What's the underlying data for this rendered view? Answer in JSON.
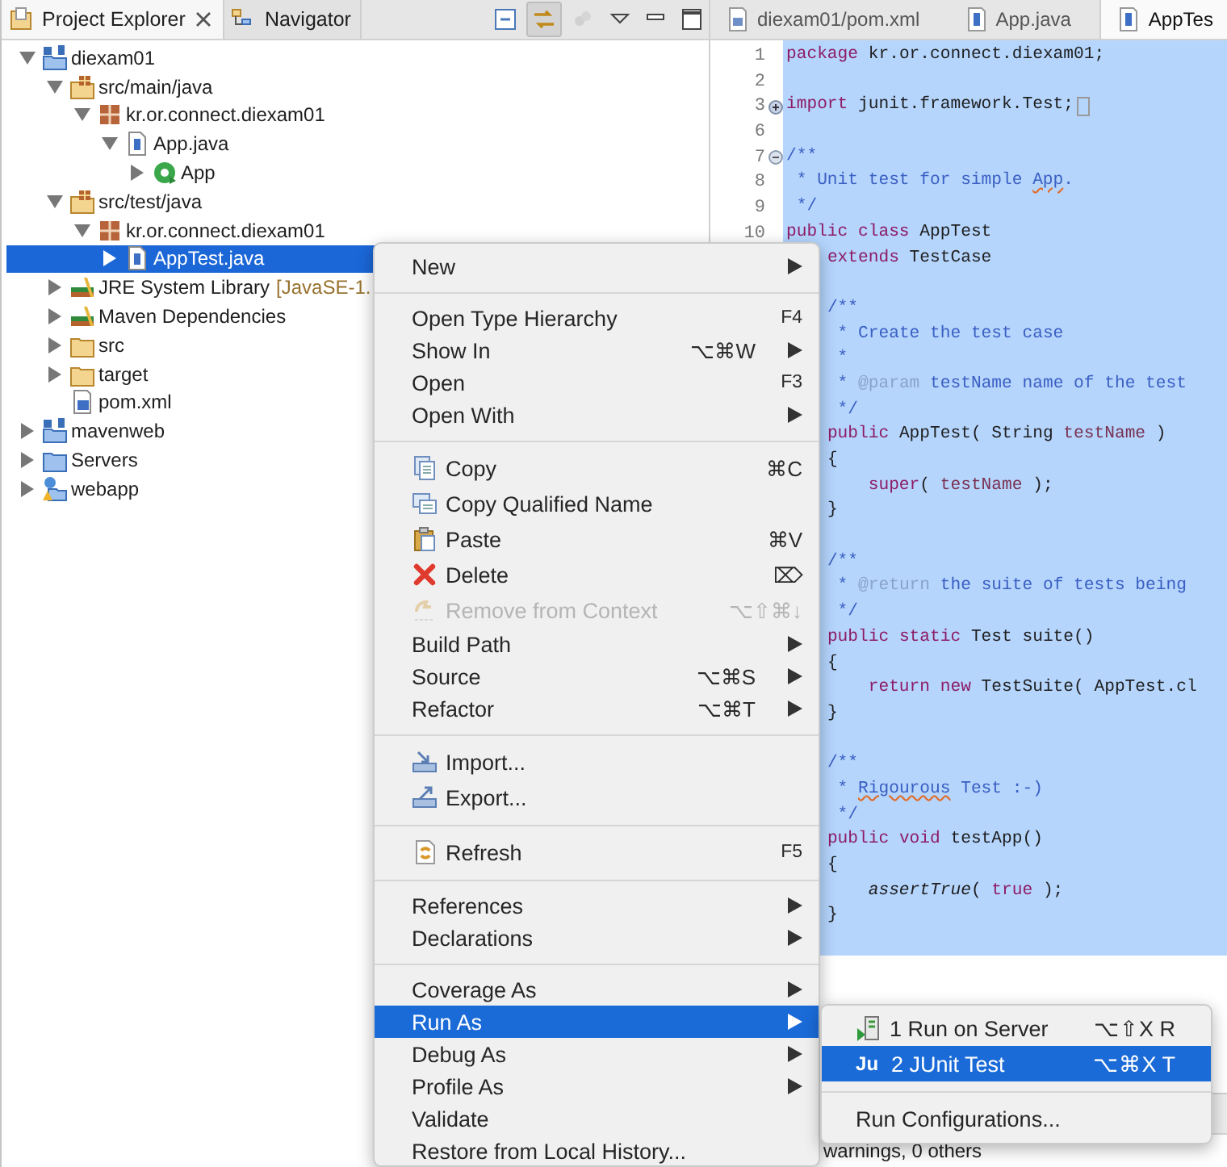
{
  "view_tabs": [
    {
      "label": "Project Explorer",
      "kind": "explorer",
      "selected": true
    },
    {
      "label": "Navigator",
      "kind": "navigator",
      "selected": false
    }
  ],
  "view_toolbar": [
    {
      "kind": "collapse-all",
      "on": false,
      "disabled": false
    },
    {
      "kind": "link",
      "on": true,
      "disabled": false
    },
    {
      "kind": "filter",
      "on": false,
      "disabled": true
    }
  ],
  "tree": [
    {
      "label": "diexam01",
      "kind": "maven-project",
      "expanded": true,
      "selected": false,
      "children": [
        {
          "label": "src/main/java",
          "kind": "source-folder",
          "expanded": true,
          "selected": false,
          "children": [
            {
              "label": "kr.or.connect.diexam01",
              "kind": "package",
              "expanded": true,
              "selected": false,
              "children": [
                {
                  "label": "App.java",
                  "kind": "java-file",
                  "expanded": true,
                  "selected": false,
                  "children": [
                    {
                      "label": "App",
                      "kind": "class",
                      "expanded": false,
                      "selected": false
                    }
                  ]
                }
              ]
            }
          ]
        },
        {
          "label": "src/test/java",
          "kind": "source-folder",
          "expanded": true,
          "selected": false,
          "children": [
            {
              "label": "kr.or.connect.diexam01",
              "kind": "package",
              "expanded": true,
              "selected": false,
              "children": [
                {
                  "label": "AppTest.java",
                  "kind": "java-file",
                  "expanded": false,
                  "selected": true
                }
              ]
            }
          ]
        },
        {
          "label": "JRE System Library",
          "detail": "[JavaSE-1.",
          "kind": "library",
          "expanded": false,
          "selected": false
        },
        {
          "label": "Maven Dependencies",
          "kind": "library",
          "expanded": false,
          "selected": false
        },
        {
          "label": "src",
          "kind": "folder",
          "expanded": false,
          "selected": false
        },
        {
          "label": "target",
          "kind": "folder",
          "expanded": false,
          "selected": false
        },
        {
          "label": "pom.xml",
          "kind": "xml-file",
          "selected": false
        }
      ]
    },
    {
      "label": "mavenweb",
      "kind": "maven-project",
      "expanded": false,
      "selected": false
    },
    {
      "label": "Servers",
      "kind": "server-folder",
      "expanded": false,
      "selected": false
    },
    {
      "label": "webapp",
      "kind": "web-project",
      "expanded": false,
      "selected": false
    }
  ],
  "editor_tabs": [
    {
      "label": "diexam01/pom.xml",
      "kind": "xml",
      "selected": false
    },
    {
      "label": "App.java",
      "kind": "java",
      "selected": false
    },
    {
      "label": "AppTes",
      "kind": "java",
      "selected": true
    }
  ],
  "code_lines": [
    {
      "kind": "code",
      "number": "1",
      "segments": [
        {
          "kind": "keyword",
          "text": "package"
        },
        {
          "kind": "plain",
          "text": " kr.or.connect.diexam01;"
        }
      ]
    },
    {
      "kind": "blank",
      "number": "2"
    },
    {
      "kind": "code",
      "number": "3",
      "expanded": false,
      "segments": [
        {
          "kind": "keyword",
          "text": "import"
        },
        {
          "kind": "plain",
          "text": " junit.framework.Test;"
        }
      ]
    },
    {
      "kind": "blank",
      "number": "6"
    },
    {
      "kind": "code",
      "number": "7",
      "expanded": true,
      "segments": [
        {
          "kind": "doc",
          "text": "/**"
        }
      ]
    },
    {
      "kind": "code",
      "number": "8",
      "segments": [
        {
          "kind": "doc",
          "text": " * Unit test for simple "
        },
        {
          "kind": "misspelled",
          "text": "App"
        },
        {
          "kind": "doc",
          "text": "."
        }
      ]
    },
    {
      "kind": "code",
      "number": "9",
      "segments": [
        {
          "kind": "doc",
          "text": " */"
        }
      ]
    },
    {
      "kind": "code",
      "number": "10",
      "segments": [
        {
          "kind": "keyword",
          "text": "public class"
        },
        {
          "kind": "plain",
          "text": " AppTest"
        }
      ]
    },
    {
      "kind": "code",
      "segments": [
        {
          "kind": "keyword",
          "text": "    extends"
        },
        {
          "kind": "plain",
          "text": " TestCase"
        }
      ]
    },
    {
      "kind": "blank"
    },
    {
      "kind": "code",
      "segments": [
        {
          "kind": "doc",
          "text": "    /**"
        }
      ]
    },
    {
      "kind": "code",
      "segments": [
        {
          "kind": "doc",
          "text": "     * Create the test case"
        }
      ]
    },
    {
      "kind": "code",
      "segments": [
        {
          "kind": "doc",
          "text": "     *"
        }
      ]
    },
    {
      "kind": "code",
      "segments": [
        {
          "kind": "doc",
          "text": "     * "
        },
        {
          "kind": "tag",
          "text": "@param"
        },
        {
          "kind": "doc",
          "text": " testName name of the test"
        }
      ]
    },
    {
      "kind": "code",
      "segments": [
        {
          "kind": "doc",
          "text": "     */"
        }
      ]
    },
    {
      "kind": "code",
      "segments": [
        {
          "kind": "keyword",
          "text": "    public"
        },
        {
          "kind": "plain",
          "text": " AppTest( String "
        },
        {
          "kind": "param",
          "text": "testName"
        },
        {
          "kind": "plain",
          "text": " )"
        }
      ]
    },
    {
      "kind": "code",
      "segments": [
        {
          "kind": "plain",
          "text": "    {"
        }
      ]
    },
    {
      "kind": "code",
      "segments": [
        {
          "kind": "keyword",
          "text": "        super"
        },
        {
          "kind": "plain",
          "text": "( "
        },
        {
          "kind": "param",
          "text": "testName"
        },
        {
          "kind": "plain",
          "text": " );"
        }
      ]
    },
    {
      "kind": "code",
      "segments": [
        {
          "kind": "plain",
          "text": "    }"
        }
      ]
    },
    {
      "kind": "blank"
    },
    {
      "kind": "code",
      "segments": [
        {
          "kind": "doc",
          "text": "    /**"
        }
      ]
    },
    {
      "kind": "code",
      "segments": [
        {
          "kind": "doc",
          "text": "     * "
        },
        {
          "kind": "tag",
          "text": "@return"
        },
        {
          "kind": "doc",
          "text": " the suite of tests being"
        }
      ]
    },
    {
      "kind": "code",
      "segments": [
        {
          "kind": "doc",
          "text": "     */"
        }
      ]
    },
    {
      "kind": "code",
      "segments": [
        {
          "kind": "keyword",
          "text": "    public static"
        },
        {
          "kind": "plain",
          "text": " Test suite()"
        }
      ]
    },
    {
      "kind": "code",
      "segments": [
        {
          "kind": "plain",
          "text": "    {"
        }
      ]
    },
    {
      "kind": "code",
      "segments": [
        {
          "kind": "keyword",
          "text": "        return new"
        },
        {
          "kind": "plain",
          "text": " TestSuite( AppTest.cl"
        }
      ]
    },
    {
      "kind": "code",
      "segments": [
        {
          "kind": "plain",
          "text": "    }"
        }
      ]
    },
    {
      "kind": "blank"
    },
    {
      "kind": "code",
      "segments": [
        {
          "kind": "doc",
          "text": "    /**"
        }
      ]
    },
    {
      "kind": "code",
      "segments": [
        {
          "kind": "doc",
          "text": "     * "
        },
        {
          "kind": "misspelled",
          "text": "Rigourous"
        },
        {
          "kind": "doc",
          "text": " Test :-)"
        }
      ]
    },
    {
      "kind": "code",
      "segments": [
        {
          "kind": "doc",
          "text": "     */"
        }
      ]
    },
    {
      "kind": "code",
      "segments": [
        {
          "kind": "keyword",
          "text": "    public void"
        },
        {
          "kind": "plain",
          "text": " testApp()"
        }
      ]
    },
    {
      "kind": "code",
      "segments": [
        {
          "kind": "plain",
          "text": "    {"
        }
      ]
    },
    {
      "kind": "code",
      "segments": [
        {
          "kind": "static",
          "text": "        assertTrue"
        },
        {
          "kind": "plain",
          "text": "( "
        },
        {
          "kind": "keyword",
          "text": "true"
        },
        {
          "kind": "plain",
          "text": " );"
        }
      ]
    },
    {
      "kind": "code",
      "segments": [
        {
          "kind": "plain",
          "text": "    }"
        }
      ]
    }
  ],
  "bottom_panel": {
    "text": "warnings, 0 others"
  },
  "context_menu": {
    "items": [
      {
        "kind": "item",
        "label": "New",
        "submenu": true,
        "disabled": false,
        "selected": false
      },
      {
        "kind": "separator"
      },
      {
        "kind": "item",
        "label": "Open Type Hierarchy",
        "shortcut": "F4",
        "submenu": false,
        "disabled": false,
        "selected": false
      },
      {
        "kind": "item",
        "label": "Show In",
        "shortcut": "⌥⌘W",
        "submenu": true,
        "disabled": false,
        "selected": false
      },
      {
        "kind": "item",
        "label": "Open",
        "shortcut": "F3",
        "submenu": false,
        "disabled": false,
        "selected": false
      },
      {
        "kind": "item",
        "label": "Open With",
        "submenu": true,
        "disabled": false,
        "selected": false
      },
      {
        "kind": "separator"
      },
      {
        "kind": "item",
        "label": "Copy",
        "shortcut": "⌘C",
        "submenu": false,
        "disabled": false,
        "selected": false
      },
      {
        "kind": "item",
        "label": "Copy Qualified Name",
        "submenu": false,
        "disabled": false,
        "selected": false
      },
      {
        "kind": "item",
        "label": "Paste",
        "shortcut": "⌘V",
        "submenu": false,
        "disabled": false,
        "selected": false
      },
      {
        "kind": "item",
        "label": "Delete",
        "shortcut": "⌦",
        "submenu": false,
        "disabled": false,
        "selected": false
      },
      {
        "kind": "item",
        "label": "Remove from Context",
        "shortcut": "⌥⇧⌘↓",
        "submenu": false,
        "disabled": true,
        "selected": false
      },
      {
        "kind": "item",
        "label": "Build Path",
        "submenu": true,
        "disabled": false,
        "selected": false
      },
      {
        "kind": "item",
        "label": "Source",
        "shortcut": "⌥⌘S",
        "submenu": true,
        "disabled": false,
        "selected": false
      },
      {
        "kind": "item",
        "label": "Refactor",
        "shortcut": "⌥⌘T",
        "submenu": true,
        "disabled": false,
        "selected": false
      },
      {
        "kind": "separator"
      },
      {
        "kind": "item",
        "label": "Import...",
        "submenu": false,
        "disabled": false,
        "selected": false
      },
      {
        "kind": "item",
        "label": "Export...",
        "submenu": false,
        "disabled": false,
        "selected": false
      },
      {
        "kind": "separator"
      },
      {
        "kind": "item",
        "label": "Refresh",
        "shortcut": "F5",
        "submenu": false,
        "disabled": false,
        "selected": false
      },
      {
        "kind": "separator"
      },
      {
        "kind": "item",
        "label": "References",
        "submenu": true,
        "disabled": false,
        "selected": false
      },
      {
        "kind": "item",
        "label": "Declarations",
        "submenu": true,
        "disabled": false,
        "selected": false
      },
      {
        "kind": "separator"
      },
      {
        "kind": "item",
        "label": "Coverage As",
        "submenu": true,
        "disabled": false,
        "selected": false
      },
      {
        "kind": "item",
        "label": "Run As",
        "submenu": true,
        "disabled": false,
        "selected": true
      },
      {
        "kind": "item",
        "label": "Debug As",
        "submenu": true,
        "disabled": false,
        "selected": false
      },
      {
        "kind": "item",
        "label": "Profile As",
        "submenu": true,
        "disabled": false,
        "selected": false
      },
      {
        "kind": "item",
        "label": "Validate",
        "submenu": false,
        "disabled": false,
        "selected": false
      },
      {
        "kind": "item",
        "label": "Restore from Local History...",
        "submenu": false,
        "disabled": false,
        "selected": false
      }
    ]
  },
  "submenu": {
    "items": [
      {
        "kind": "item",
        "label": "1 Run on Server",
        "shortcut": "⌥⇧X R",
        "selected": false
      },
      {
        "kind": "item",
        "label": "2 JUnit Test",
        "icon_text": "Ju",
        "shortcut": "⌥⌘X T",
        "selected": true
      },
      {
        "kind": "separator"
      },
      {
        "kind": "item",
        "label": "Run Configurations...",
        "selected": false
      }
    ]
  }
}
